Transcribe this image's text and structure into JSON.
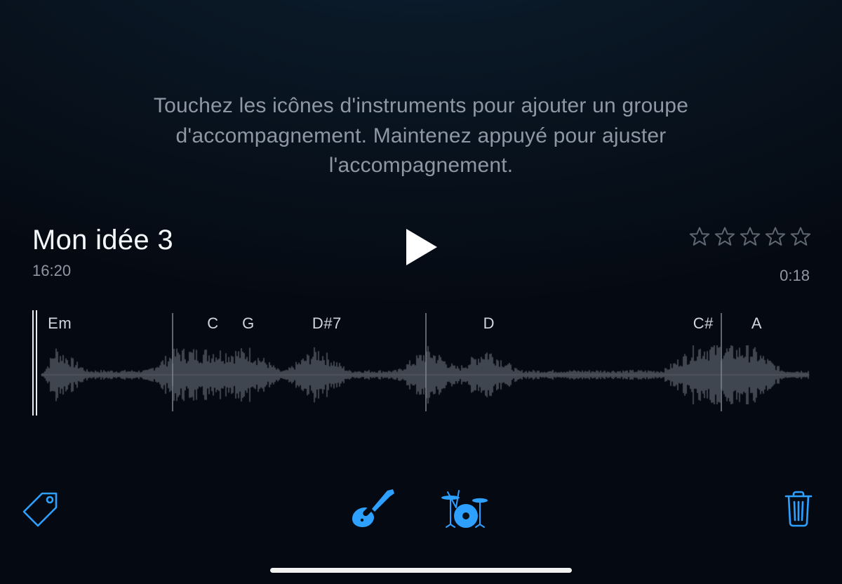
{
  "instruction": "Touchez les icônes d'instruments pour ajouter un groupe d'accompagnement. Maintenez appuyé pour ajuster l'accompagnement.",
  "title": "Mon idée 3",
  "timestamp": "16:20",
  "duration": "0:18",
  "rating": {
    "stars": 5,
    "filled": 0
  },
  "chords": [
    {
      "label": "Em",
      "positionPct": 2,
      "barMarker": true
    },
    {
      "label": "C",
      "positionPct": 22.5,
      "barMarker": false
    },
    {
      "label": "G",
      "positionPct": 27,
      "barMarker": false
    },
    {
      "label": "D#7",
      "positionPct": 36,
      "barMarker": false
    },
    {
      "label": "D",
      "positionPct": 58,
      "barMarker": false
    },
    {
      "label": "C#",
      "positionPct": 85,
      "barMarker": false
    },
    {
      "label": "A",
      "positionPct": 92.5,
      "barMarker": false
    }
  ],
  "barMarkers": [
    18,
    50.5,
    88.5
  ],
  "icons": {
    "tag": "tag-icon",
    "guitar": "guitar-icon",
    "drums": "drums-icon",
    "trash": "trash-icon"
  },
  "colors": {
    "accent": "#2ea0ff",
    "wave": "#7c838c",
    "textDim": "#8e97a3"
  }
}
